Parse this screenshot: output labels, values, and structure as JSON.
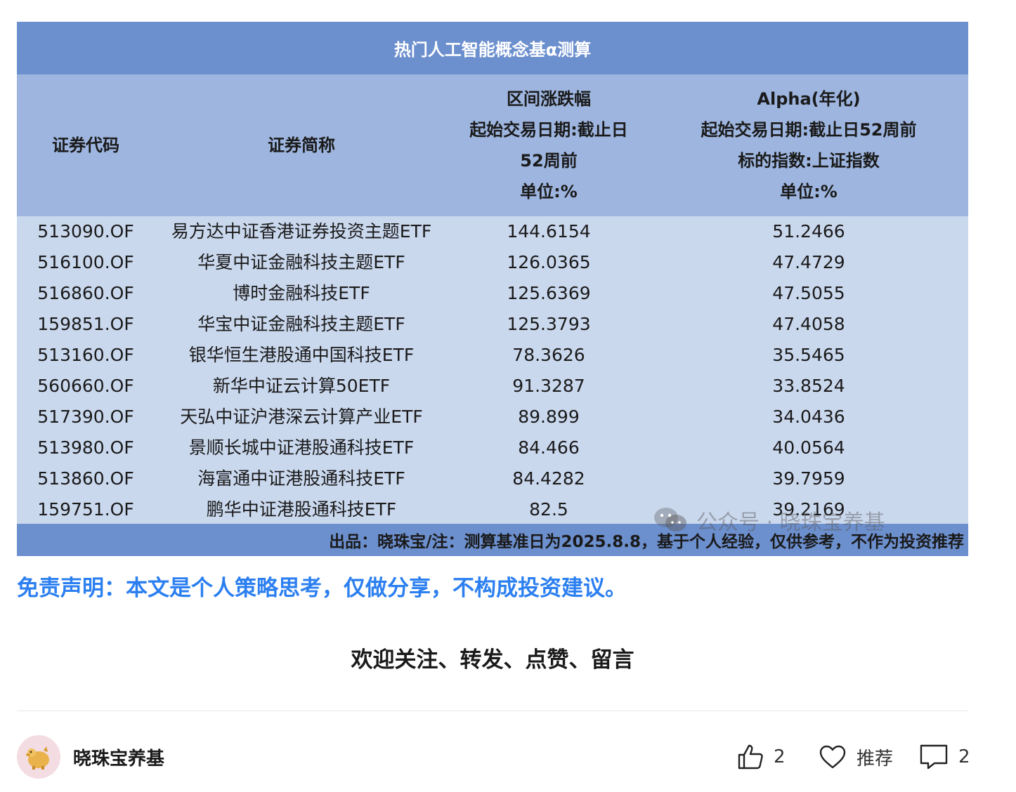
{
  "table": {
    "title": "热门人工智能概念基α测算",
    "headers": {
      "code": "证券代码",
      "name": "证券简称",
      "change": [
        "区间涨跌幅",
        "起始交易日期:截止日",
        "52周前",
        "单位:%"
      ],
      "alpha": [
        "Alpha(年化)",
        "起始交易日期:截止日52周前",
        "标的指数:上证指数",
        "单位:%"
      ]
    },
    "rows": [
      {
        "code": "513090.OF",
        "name": "易方达中证香港证券投资主题ETF",
        "change": "144.6154",
        "alpha": "51.2466"
      },
      {
        "code": "516100.OF",
        "name": "华夏中证金融科技主题ETF",
        "change": "126.0365",
        "alpha": "47.4729"
      },
      {
        "code": "516860.OF",
        "name": "博时金融科技ETF",
        "change": "125.6369",
        "alpha": "47.5055"
      },
      {
        "code": "159851.OF",
        "name": "华宝中证金融科技主题ETF",
        "change": "125.3793",
        "alpha": "47.4058"
      },
      {
        "code": "513160.OF",
        "name": "银华恒生港股通中国科技ETF",
        "change": "78.3626",
        "alpha": "35.5465"
      },
      {
        "code": "560660.OF",
        "name": "新华中证云计算50ETF",
        "change": "91.3287",
        "alpha": "33.8524"
      },
      {
        "code": "517390.OF",
        "name": "天弘中证沪港深云计算产业ETF",
        "change": "89.899",
        "alpha": "34.0436"
      },
      {
        "code": "513980.OF",
        "name": "景顺长城中证港股通科技ETF",
        "change": "84.466",
        "alpha": "40.0564"
      },
      {
        "code": "513860.OF",
        "name": "海富通中证港股通科技ETF",
        "change": "84.4282",
        "alpha": "39.7959"
      },
      {
        "code": "159751.OF",
        "name": "鹏华中证港股通科技ETF",
        "change": "82.5",
        "alpha": "39.2169"
      }
    ],
    "footer": "出品：晓珠宝/注：测算基准日为2025.8.8，基于个人经验，仅供参考，不作为投资推荐",
    "watermark": "公众号 · 晓珠宝养基"
  },
  "disclaimer": "免责声明：本文是个人策略思考，仅做分享，不构成投资建议。",
  "welcome": "欢迎关注、转发、点赞、留言",
  "author": {
    "name": "晓珠宝养基"
  },
  "actions": {
    "like_count": "2",
    "recommend_label": "推荐",
    "comment_count": "2"
  },
  "colors": {
    "title_bar": "#6c8fce",
    "header_bg": "#9db5df",
    "body_bg": "#cad8ee",
    "disclaimer": "#2b7ff0"
  },
  "icons": [
    "wechat-icon",
    "thumbs-up-icon",
    "heart-icon",
    "comment-icon",
    "piggy-bank-avatar"
  ]
}
